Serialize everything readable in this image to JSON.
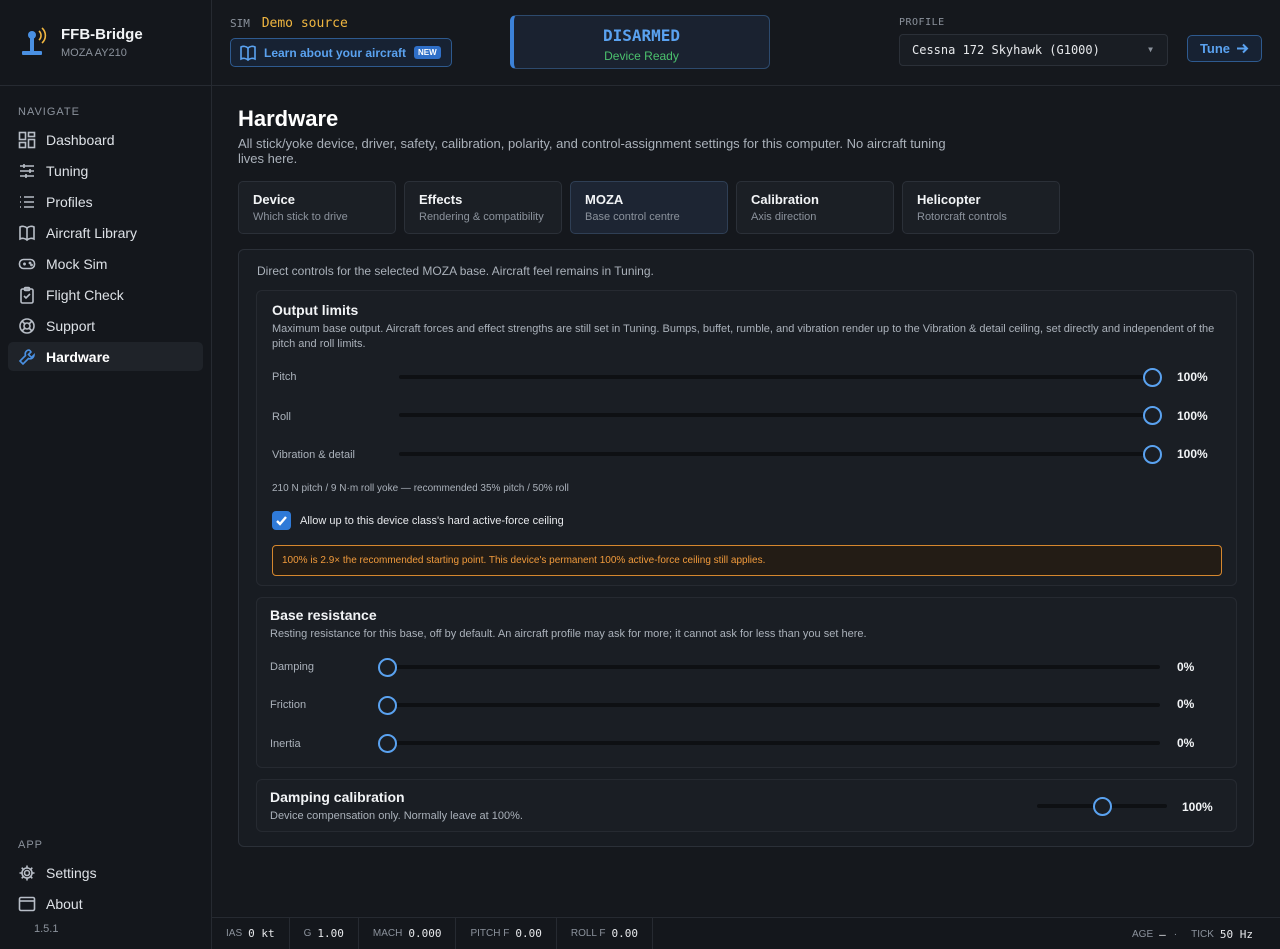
{
  "brand": {
    "name": "FFB-Bridge",
    "device": "MOZA AY210",
    "logo_icon": "joystick-icon"
  },
  "sidebar": {
    "navigate_label": "NAVIGATE",
    "items": [
      {
        "label": "Dashboard",
        "icon": "dashboard-icon"
      },
      {
        "label": "Tuning",
        "icon": "sliders-icon"
      },
      {
        "label": "Profiles",
        "icon": "list-icon"
      },
      {
        "label": "Aircraft Library",
        "icon": "book-icon"
      },
      {
        "label": "Mock Sim",
        "icon": "gamepad-icon"
      },
      {
        "label": "Flight Check",
        "icon": "clipboard-check-icon"
      },
      {
        "label": "Support",
        "icon": "lifebuoy-icon"
      },
      {
        "label": "Hardware",
        "icon": "wrench-icon",
        "active": true
      }
    ],
    "app_label": "APP",
    "app_items": [
      {
        "label": "Settings",
        "icon": "gear-icon"
      },
      {
        "label": "About",
        "icon": "window-icon"
      }
    ],
    "version": "1.5.1"
  },
  "topbar": {
    "sim_key": "SIM",
    "sim_value": "Demo source",
    "learn_label": "Learn about your aircraft",
    "learn_badge": "NEW",
    "status_main": "DISARMED",
    "status_sub": "Device Ready",
    "profile_label": "PROFILE",
    "profile_value": "Cessna 172 Skyhawk (G1000)",
    "tune_label": "Tune"
  },
  "page": {
    "title": "Hardware",
    "description": "All stick/yoke device, driver, safety, calibration, polarity, and control-assignment settings for this computer. No aircraft tuning lives here.",
    "tabs": [
      {
        "title": "Device",
        "sub": "Which stick to drive"
      },
      {
        "title": "Effects",
        "sub": "Rendering & compatibility"
      },
      {
        "title": "MOZA",
        "sub": "Base control centre",
        "active": true
      },
      {
        "title": "Calibration",
        "sub": "Axis direction"
      },
      {
        "title": "Helicopter",
        "sub": "Rotorcraft controls"
      }
    ],
    "panel_intro": "Direct controls for the selected MOZA base. Aircraft feel remains in Tuning."
  },
  "output_limits": {
    "title": "Output limits",
    "description": "Maximum base output. Aircraft forces and effect strengths are still set in Tuning. Bumps, buffet, rumble, and vibration render up to the Vibration & detail ceiling, set directly and independent of the pitch and roll limits.",
    "sliders": [
      {
        "label": "Pitch",
        "value": 100,
        "display": "100%"
      },
      {
        "label": "Roll",
        "value": 100,
        "display": "100%"
      },
      {
        "label": "Vibration & detail",
        "value": 100,
        "display": "100%"
      }
    ],
    "note": "210 N pitch / 9 N·m roll yoke — recommended 35% pitch / 50% roll",
    "checkbox_label": "Allow up to this device class's hard active-force ceiling",
    "checkbox_checked": true,
    "warning": "100% is 2.9× the recommended starting point. This device's permanent 100% active-force ceiling still applies."
  },
  "base_resistance": {
    "title": "Base resistance",
    "description": "Resting resistance for this base, off by default. An aircraft profile may ask for more; it cannot ask for less than you set here.",
    "sliders": [
      {
        "label": "Damping",
        "value": 0,
        "display": "0%"
      },
      {
        "label": "Friction",
        "value": 0,
        "display": "0%"
      },
      {
        "label": "Inertia",
        "value": 0,
        "display": "0%"
      }
    ]
  },
  "damping_calibration": {
    "title": "Damping calibration",
    "description": "Device compensation only. Normally leave at 100%.",
    "value": 50,
    "display": "100%"
  },
  "statusbar": {
    "ias_label": "IAS",
    "ias_value": "0 kt",
    "g_label": "G",
    "g_value": "1.00",
    "mach_label": "MACH",
    "mach_value": "0.000",
    "pitchf_label": "PITCH F",
    "pitchf_value": "0.00",
    "rollf_label": "ROLL F",
    "rollf_value": "0.00",
    "age_label": "AGE",
    "age_value": "—",
    "sep": "·",
    "tick_label": "TICK",
    "tick_value": "50 Hz"
  },
  "colors": {
    "accent": "#4a90e2",
    "warning": "#f09a3c",
    "ready": "#4bc16d",
    "sim": "#f0b640"
  }
}
